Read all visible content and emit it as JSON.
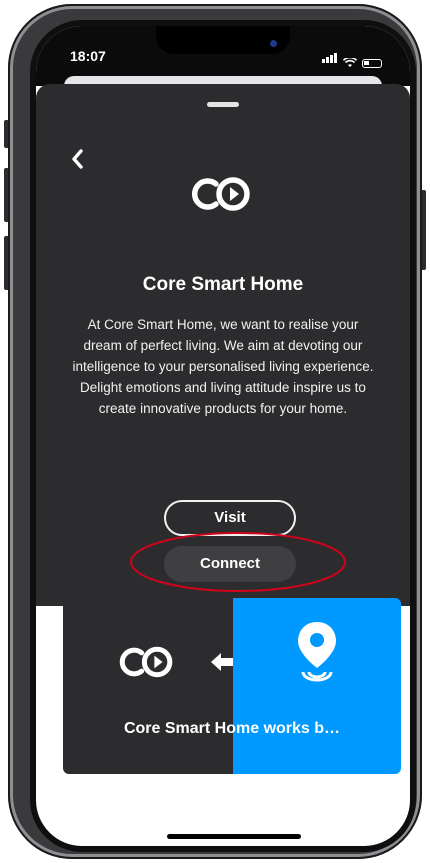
{
  "status_bar": {
    "time": "18:07"
  },
  "sheet": {
    "title": "Core Smart Home",
    "description": "At Core Smart Home, we want to realise your dream of perfect living. We aim at devoting our intelligence to your personalised living experience. Delight emotions and living attitude inspire us to create innovative products for your home.",
    "visit_label": "Visit",
    "connect_label": "Connect"
  },
  "card": {
    "title": "Core Smart Home works b…"
  },
  "colors": {
    "sheet_bg": "#2c2c2e",
    "card_accent": "#0099ff",
    "highlight_ring": "#d0021b"
  },
  "icons": [
    "back-chevron-icon",
    "core-logo-icon",
    "swap-arrows-icon",
    "location-pin-icon",
    "signal-icon",
    "wifi-icon",
    "battery-icon"
  ]
}
